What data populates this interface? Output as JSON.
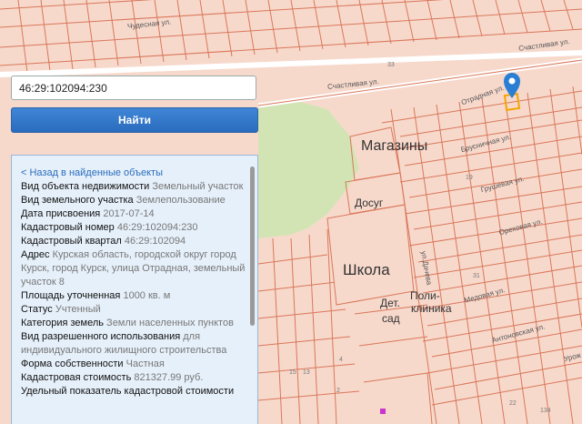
{
  "search": {
    "value": "46:29:102094:230",
    "button_label": "Найти"
  },
  "panel": {
    "back_link": "< Назад в найденные объекты",
    "rows": [
      {
        "label": "Вид объекта недвижимости",
        "value": "Земельный участок"
      },
      {
        "label": "Вид земельного участка",
        "value": "Землепользование"
      },
      {
        "label": "Дата присвоения",
        "value": "2017-07-14"
      },
      {
        "label": "Кадастровый номер",
        "value": "46:29:102094:230"
      },
      {
        "label": "Кадастровый квартал",
        "value": "46:29:102094"
      },
      {
        "label": "Адрес",
        "value": "Курская область, городской округ город Курск, город Курск, улица Отрадная, земельный участок 8"
      },
      {
        "label": "Площадь уточненная",
        "value": "1000 кв. м"
      },
      {
        "label": "Статус",
        "value": "Учтенный"
      },
      {
        "label": "Категория земель",
        "value": "Земли населенных пунктов"
      },
      {
        "label": "Вид разрешенного использования",
        "value": "для индивидуального жилищного строительства"
      },
      {
        "label": "Форма собственности",
        "value": "Частная"
      },
      {
        "label": "Кадастровая стоимость",
        "value": "821327.99 руб."
      },
      {
        "label": "Удельный показатель кадастровой стоимости",
        "value": ""
      }
    ]
  },
  "map": {
    "streets": {
      "chudesnaya": "Чудесная ул.",
      "schastlivaya_left": "Счастливая ул.",
      "schastlivaya_right": "Счастливая ул.",
      "otradnaya": "Отрадная ул.",
      "brusnichnaya": "Брусничная ул.",
      "grushevaya": "Грушевая ул.",
      "orekhovaya": "Ореховая ул.",
      "dacheva": "ул.Дачева",
      "medovaya": "Медовая ул.",
      "antonovskaya": "Антоновская ул.",
      "urozh": "Урож"
    },
    "places": {
      "shops": "Магазины",
      "leisure": "Досуг",
      "school": "Школа",
      "kinder_1": "Дет.",
      "kinder_2": "сад",
      "clinic_1": "Поли-",
      "clinic_2": "клиника"
    },
    "numbers": {
      "n33": "33",
      "n19": "19",
      "n31": "31",
      "n2": "2",
      "n15": "15",
      "n13": "13",
      "n4": "4",
      "n22": "22",
      "n134": "134"
    },
    "colors": {
      "land": "#f7d9cc",
      "lines": "#d9775a",
      "green": "#d3e4b4",
      "road": "#ffffff",
      "marker": "#2a7fd4",
      "parcel": "#f5a300"
    }
  }
}
